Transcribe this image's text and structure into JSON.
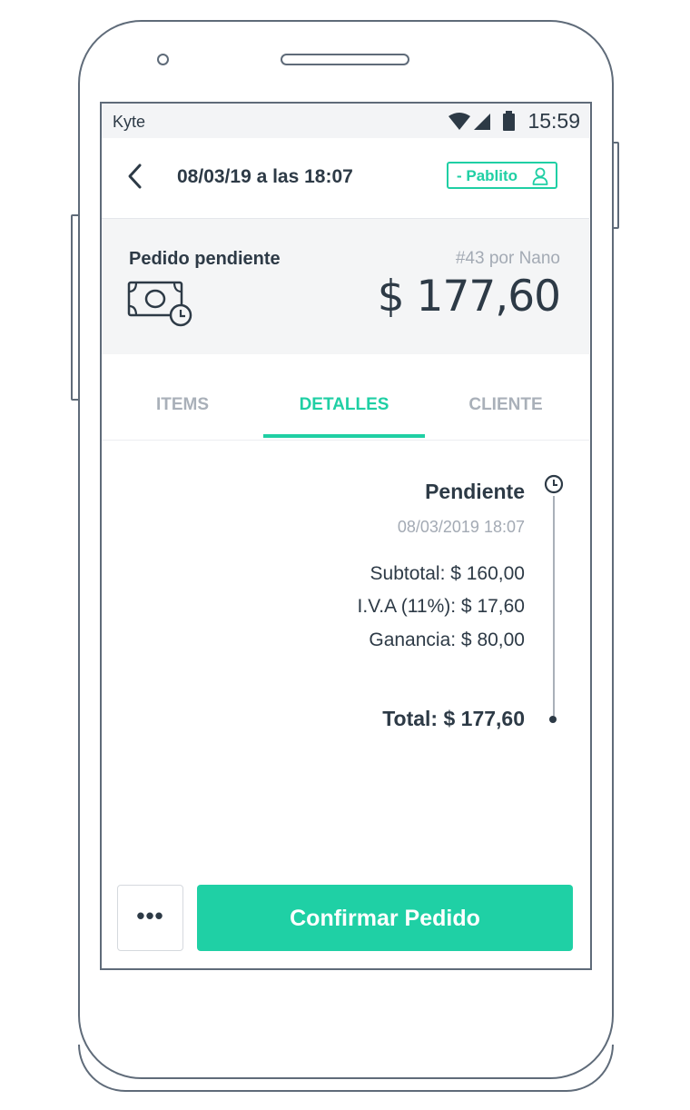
{
  "statusbar": {
    "app_name": "Kyte",
    "time": "15:59",
    "icons": [
      "wifi-icon",
      "signal-icon",
      "battery-icon"
    ]
  },
  "header": {
    "title": "08/03/19 a las 18:07",
    "seller": "- Pablito",
    "icons": [
      "back-arrow-icon",
      "user-icon"
    ]
  },
  "summary": {
    "status": "Pedido pendiente",
    "order_ref": "#43 por Nano",
    "amount": "$ 177,60",
    "icon": "money-clock-icon"
  },
  "tabs": [
    {
      "label": "ITEMS",
      "active": false
    },
    {
      "label": "DETALLES",
      "active": true
    },
    {
      "label": "CLIENTE",
      "active": false
    }
  ],
  "details": {
    "status": "Pendiente",
    "date": "08/03/2019 18:07",
    "subtotal": "Subtotal: $ 160,00",
    "tax": "I.V.A (11%): $ 17,60",
    "profit": "Ganancia: $ 80,00",
    "total": "Total: $ 177,60"
  },
  "actions": {
    "more_label": "•••",
    "confirm_label": "Confirmar Pedido"
  },
  "colors": {
    "accent": "#1fd0a5",
    "text": "#2d3a46",
    "muted": "#a3aab4",
    "summary_bg": "#f4f5f6",
    "frame": "#5f6b79"
  }
}
